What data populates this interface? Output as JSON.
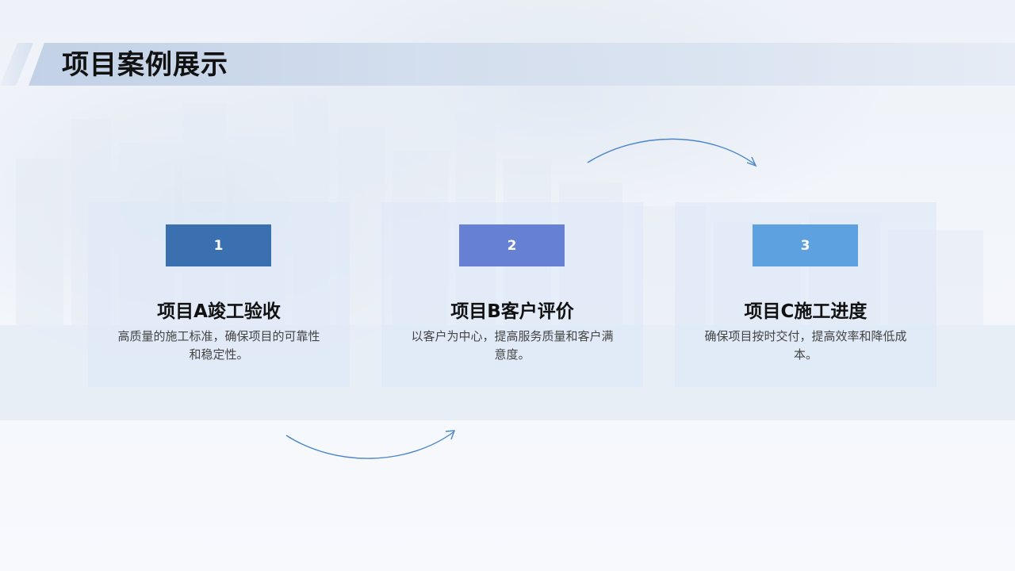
{
  "page_title": "项目案例展示",
  "cards": [
    {
      "number": "1",
      "title": "项目A竣工验收",
      "description": "高质量的施工标准，确保项目的可靠性和稳定性。",
      "color": "#3a6fb0"
    },
    {
      "number": "2",
      "title": "项目B客户评价",
      "description": "以客户为中心，提高服务质量和客户满意度。",
      "color": "#6681d3"
    },
    {
      "number": "3",
      "title": "项目C施工进度",
      "description": "确保项目按时交付，提高效率和降低成本。",
      "color": "#5ea1e1"
    }
  ],
  "colors": {
    "accent": "#3a6fb0",
    "arrow": "#4a86c8",
    "card_bg": "#dde8f7"
  }
}
